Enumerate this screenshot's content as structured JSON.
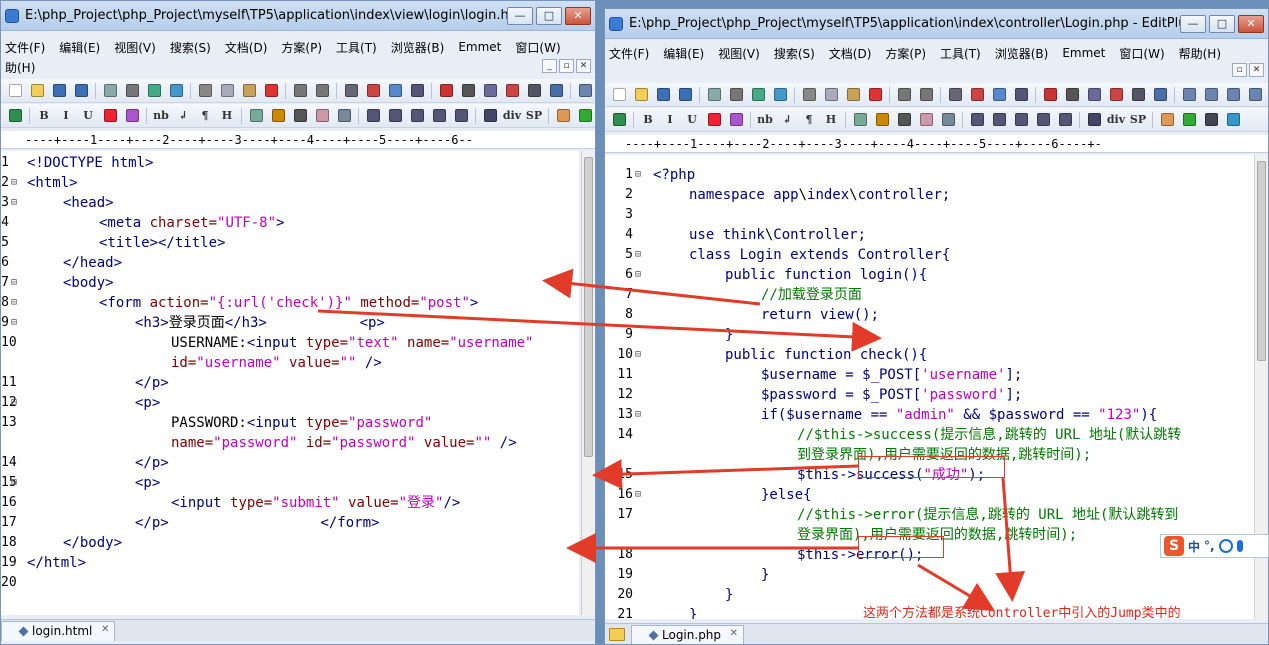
{
  "left": {
    "title": "E:\\php_Project\\php_Project\\myself\\TP5\\application\\index\\view\\login\\login.html - Edi...",
    "menus": [
      "文件(F)",
      "编辑(E)",
      "视图(V)",
      "搜索(S)",
      "文档(D)",
      "方案(P)",
      "工具(T)",
      "浏览器(B)",
      "Emmet",
      "窗口(W)"
    ],
    "menu_row2": "助(H)",
    "ruler": "----+----1----+----2----+----3----+----4----+----5----+----6--",
    "tab": "login.html",
    "lines": [
      {
        "n": "1",
        "fold": "",
        "indent": 0,
        "parts": [
          [
            "t-tag",
            "<!DOCTYPE html>"
          ]
        ]
      },
      {
        "n": "2",
        "fold": "⊟",
        "indent": 0,
        "parts": [
          [
            "t-tag",
            "<html>"
          ]
        ]
      },
      {
        "n": "3",
        "fold": "⊟",
        "indent": 1,
        "parts": [
          [
            "t-tag",
            "<head>"
          ]
        ]
      },
      {
        "n": "4",
        "fold": "",
        "indent": 2,
        "parts": [
          [
            "t-tag",
            "<meta "
          ],
          [
            "t-attr",
            "charset="
          ],
          [
            "t-str",
            "\"UTF-8\""
          ],
          [
            "t-tag",
            ">"
          ]
        ]
      },
      {
        "n": "5",
        "fold": "",
        "indent": 2,
        "parts": [
          [
            "t-tag",
            "<title></title>"
          ]
        ]
      },
      {
        "n": "6",
        "fold": "",
        "indent": 1,
        "parts": [
          [
            "t-tag",
            "</head>"
          ]
        ]
      },
      {
        "n": "7",
        "fold": "⊟",
        "indent": 1,
        "parts": [
          [
            "t-tag",
            "<body>"
          ]
        ]
      },
      {
        "n": "8",
        "fold": "⊟",
        "indent": 2,
        "parts": [
          [
            "t-tag",
            "<form "
          ],
          [
            "t-attr",
            "action="
          ],
          [
            "t-str",
            "\"{:url('check')}\""
          ],
          [
            "t-attr",
            " method="
          ],
          [
            "t-str",
            "\"post\""
          ],
          [
            "t-tag",
            ">"
          ]
        ]
      },
      {
        "n": "9",
        "fold": "⊟",
        "indent": 3,
        "parts": [
          [
            "t-tag",
            "<h3>"
          ],
          [
            "t-black",
            "登录页面"
          ],
          [
            "t-tag",
            "</h3>           <p>"
          ]
        ]
      },
      {
        "n": "10",
        "fold": "",
        "indent": 4,
        "parts": [
          [
            "t-black",
            "USERNAME:"
          ],
          [
            "t-tag",
            "<input "
          ],
          [
            "t-attr",
            "type="
          ],
          [
            "t-str",
            "\"text\""
          ],
          [
            "t-attr",
            " name="
          ],
          [
            "t-str",
            "\"username\""
          ]
        ]
      },
      {
        "n": "",
        "fold": "",
        "indent": 4,
        "parts": [
          [
            "t-attr",
            "id="
          ],
          [
            "t-str",
            "\"username\""
          ],
          [
            "t-attr",
            " value="
          ],
          [
            "t-str",
            "\"\""
          ],
          [
            "t-tag",
            " />"
          ]
        ]
      },
      {
        "n": "11",
        "fold": "",
        "indent": 3,
        "parts": [
          [
            "t-tag",
            "</p>"
          ]
        ]
      },
      {
        "n": "12",
        "fold": "⊟",
        "indent": 3,
        "parts": [
          [
            "t-tag",
            "<p>"
          ]
        ]
      },
      {
        "n": "13",
        "fold": "",
        "indent": 4,
        "parts": [
          [
            "t-black",
            "PASSWORD:"
          ],
          [
            "t-tag",
            "<input "
          ],
          [
            "t-attr",
            "type="
          ],
          [
            "t-str",
            "\"password\""
          ]
        ]
      },
      {
        "n": "",
        "fold": "",
        "indent": 4,
        "parts": [
          [
            "t-attr",
            "name="
          ],
          [
            "t-str",
            "\"password\""
          ],
          [
            "t-attr",
            " id="
          ],
          [
            "t-str",
            "\"password\""
          ],
          [
            "t-attr",
            " value="
          ],
          [
            "t-str",
            "\"\""
          ],
          [
            "t-tag",
            " />"
          ]
        ]
      },
      {
        "n": "14",
        "fold": "",
        "indent": 3,
        "parts": [
          [
            "t-tag",
            "</p>"
          ]
        ]
      },
      {
        "n": "15",
        "fold": "⊟",
        "indent": 3,
        "parts": [
          [
            "t-tag",
            "<p>"
          ]
        ]
      },
      {
        "n": "16",
        "fold": "",
        "indent": 4,
        "parts": [
          [
            "t-tag",
            "<input "
          ],
          [
            "t-attr",
            "type="
          ],
          [
            "t-str",
            "\"submit\""
          ],
          [
            "t-attr",
            " value="
          ],
          [
            "t-str",
            "\"登录\""
          ],
          [
            "t-tag",
            "/>"
          ]
        ]
      },
      {
        "n": "17",
        "fold": "",
        "indent": 3,
        "parts": [
          [
            "t-tag",
            "</p>                  </form>"
          ]
        ]
      },
      {
        "n": "18",
        "fold": "",
        "indent": 1,
        "parts": [
          [
            "t-tag",
            "</body>"
          ]
        ]
      },
      {
        "n": "19",
        "fold": "",
        "indent": 0,
        "parts": [
          [
            "t-tag",
            "</html>"
          ]
        ]
      },
      {
        "n": "20",
        "fold": "",
        "indent": 0,
        "parts": []
      }
    ]
  },
  "right": {
    "title": "E:\\php_Project\\php_Project\\myself\\TP5\\application\\index\\controller\\Login.php - EditPlus",
    "menus": [
      "文件(F)",
      "编辑(E)",
      "视图(V)",
      "搜索(S)",
      "文档(D)",
      "方案(P)",
      "工具(T)",
      "浏览器(B)",
      "Emmet",
      "窗口(W)",
      "帮助(H)"
    ],
    "ruler": "----+----1----+----2----+----3----+----4----+----5----+----6----+-",
    "tab": "Login.php",
    "lines": [
      {
        "n": "1",
        "fold": "⊟",
        "indent": 0,
        "parts": [
          [
            "t-kw",
            "<?php"
          ]
        ]
      },
      {
        "n": "2",
        "fold": "",
        "indent": 1,
        "parts": [
          [
            "t-kw",
            "namespace app"
          ],
          [
            "t-black",
            "\\"
          ],
          [
            "t-kw",
            "index"
          ],
          [
            "t-black",
            "\\"
          ],
          [
            "t-kw",
            "controller;"
          ]
        ]
      },
      {
        "n": "3",
        "fold": "",
        "indent": 0,
        "parts": []
      },
      {
        "n": "4",
        "fold": "",
        "indent": 1,
        "parts": [
          [
            "t-kw",
            "use think"
          ],
          [
            "t-black",
            "\\"
          ],
          [
            "t-kw",
            "Controller;"
          ]
        ]
      },
      {
        "n": "5",
        "fold": "⊟",
        "indent": 1,
        "parts": [
          [
            "t-kw",
            "class Login extends Controller{"
          ]
        ]
      },
      {
        "n": "6",
        "fold": "⊟",
        "indent": 2,
        "parts": [
          [
            "t-kw",
            "public function login(){"
          ]
        ]
      },
      {
        "n": "7",
        "fold": "",
        "indent": 3,
        "parts": [
          [
            "t-cmt",
            "//加载登录页面"
          ]
        ]
      },
      {
        "n": "8",
        "fold": "",
        "indent": 3,
        "parts": [
          [
            "t-kw",
            "return view();"
          ]
        ]
      },
      {
        "n": "9",
        "fold": "",
        "indent": 2,
        "parts": [
          [
            "t-kw",
            "}"
          ]
        ]
      },
      {
        "n": "10",
        "fold": "⊟",
        "indent": 2,
        "parts": [
          [
            "t-kw",
            "public function check(){"
          ]
        ]
      },
      {
        "n": "11",
        "fold": "",
        "indent": 3,
        "parts": [
          [
            "t-var",
            "$username = $_POST["
          ],
          [
            "t-str",
            "'username'"
          ],
          [
            "t-var",
            "];"
          ]
        ]
      },
      {
        "n": "12",
        "fold": "",
        "indent": 3,
        "parts": [
          [
            "t-var",
            "$password = $_POST["
          ],
          [
            "t-str",
            "'password'"
          ],
          [
            "t-var",
            "];"
          ]
        ]
      },
      {
        "n": "13",
        "fold": "⊟",
        "indent": 3,
        "parts": [
          [
            "t-kw",
            "if($username == "
          ],
          [
            "t-str",
            "\"admin\""
          ],
          [
            "t-kw",
            " && $password == "
          ],
          [
            "t-str",
            "\"123\""
          ],
          [
            "t-kw",
            "){"
          ]
        ]
      },
      {
        "n": "14",
        "fold": "",
        "indent": 4,
        "parts": [
          [
            "t-cmt",
            "//$this->success(提示信息,跳转的 URL 地址(默认跳转"
          ]
        ]
      },
      {
        "n": "",
        "fold": "",
        "indent": 4,
        "parts": [
          [
            "t-cmt",
            "到登录界面),用户需要返回的数据,跳转时间);"
          ]
        ]
      },
      {
        "n": "15",
        "fold": "",
        "indent": 4,
        "parts": [
          [
            "t-var",
            "$this->success("
          ],
          [
            "t-str",
            "\"成功\""
          ],
          [
            "t-var",
            ");"
          ]
        ]
      },
      {
        "n": "16",
        "fold": "⊟",
        "indent": 3,
        "parts": [
          [
            "t-kw",
            "}else{"
          ]
        ]
      },
      {
        "n": "17",
        "fold": "",
        "indent": 4,
        "parts": [
          [
            "t-cmt",
            "//$this->error(提示信息,跳转的 URL 地址(默认跳转到"
          ]
        ]
      },
      {
        "n": "",
        "fold": "",
        "indent": 4,
        "parts": [
          [
            "t-cmt",
            "登录界面),用户需要返回的数据,跳转时间);"
          ]
        ]
      },
      {
        "n": "18",
        "fold": "",
        "indent": 4,
        "parts": [
          [
            "t-var",
            "$this->error();"
          ]
        ]
      },
      {
        "n": "19",
        "fold": "",
        "indent": 3,
        "parts": [
          [
            "t-kw",
            "}"
          ]
        ]
      },
      {
        "n": "20",
        "fold": "",
        "indent": 2,
        "parts": [
          [
            "t-kw",
            "}"
          ]
        ]
      },
      {
        "n": "21",
        "fold": "",
        "indent": 1,
        "parts": [
          [
            "t-kw",
            "}"
          ]
        ]
      }
    ]
  },
  "annotation": "这两个方法都是系统Controller中引入的Jump类中的",
  "ime": {
    "logo": "S",
    "lang": "中",
    "punct": "°,"
  },
  "colors": {
    "arrow": "#e23b2a",
    "comment": "#007a00",
    "string": "#c000c0",
    "keyword": "#000080"
  }
}
